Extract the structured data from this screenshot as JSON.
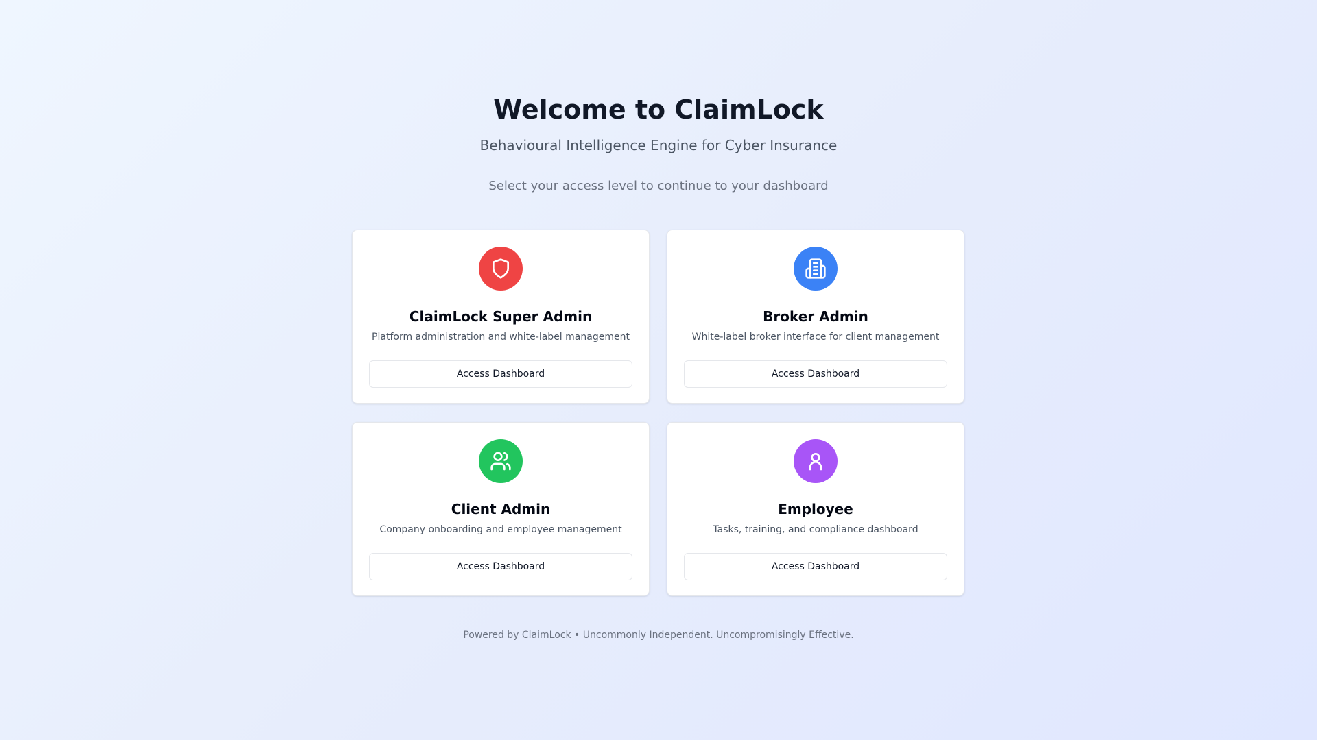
{
  "header": {
    "title": "Welcome to ClaimLock",
    "subtitle": "Behavioural Intelligence Engine for Cyber Insurance",
    "prompt": "Select your access level to continue to your dashboard"
  },
  "cards": [
    {
      "title": "ClaimLock Super Admin",
      "description": "Platform administration and white-label management",
      "button_label": "Access Dashboard",
      "icon": "shield-icon",
      "color": "#ef4444"
    },
    {
      "title": "Broker Admin",
      "description": "White-label broker interface for client management",
      "button_label": "Access Dashboard",
      "icon": "building-icon",
      "color": "#3b82f6"
    },
    {
      "title": "Client Admin",
      "description": "Company onboarding and employee management",
      "button_label": "Access Dashboard",
      "icon": "users-icon",
      "color": "#22c55e"
    },
    {
      "title": "Employee",
      "description": "Tasks, training, and compliance dashboard",
      "button_label": "Access Dashboard",
      "icon": "user-icon",
      "color": "#a855f7"
    }
  ],
  "footer": {
    "text": "Powered by ClaimLock • Uncommonly Independent. Uncompromisingly Effective."
  }
}
